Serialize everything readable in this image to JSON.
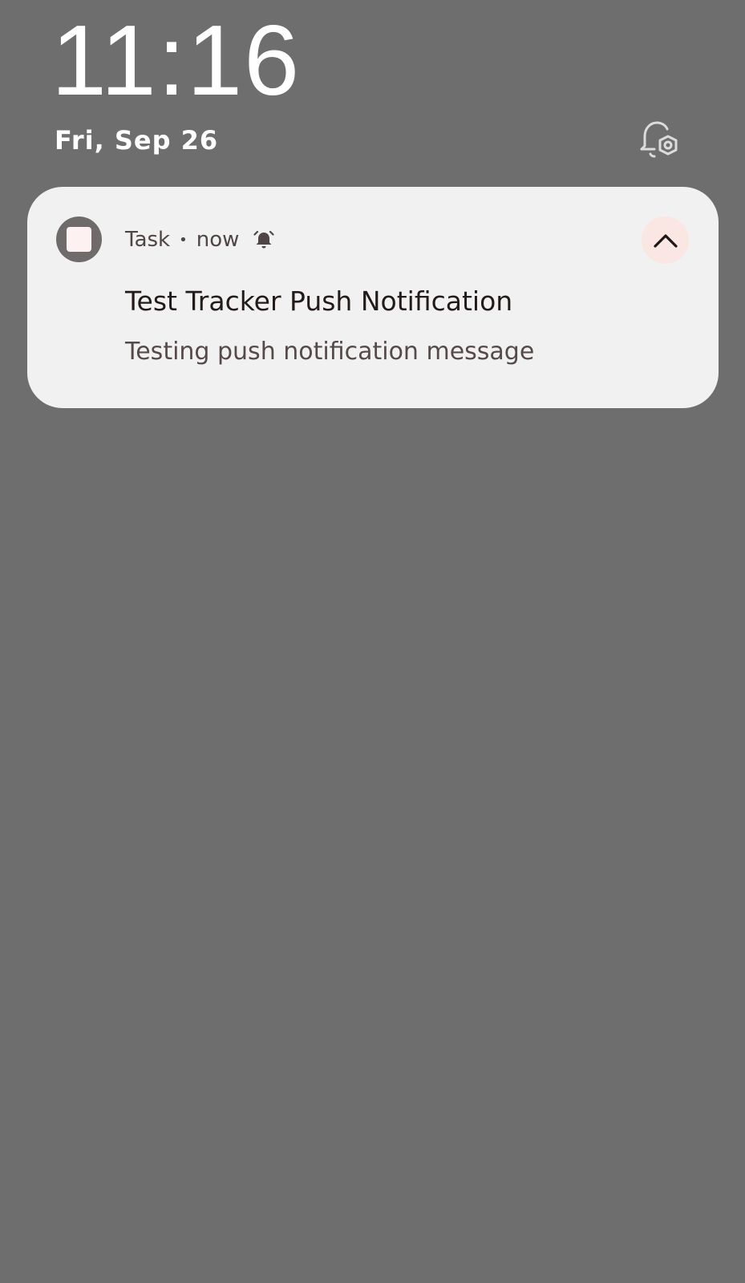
{
  "lockscreen": {
    "time": "11:16",
    "date": "Fri, Sep 26",
    "bell_settings_icon": "bell-settings-icon"
  },
  "notification": {
    "app_name": "Task",
    "separator": "•",
    "timestamp": "now",
    "alarm_icon": "alarm-bell-icon",
    "app_icon": "app-icon",
    "collapse_icon": "chevron-up-icon",
    "title": "Test Tracker Push Notification",
    "body": "Testing push notification message"
  },
  "colors": {
    "background": "#6e6e6e",
    "card": "#f2f1f1",
    "collapse_button": "#fae6e3",
    "title_text": "#231a1a",
    "body_text": "#554a49"
  }
}
